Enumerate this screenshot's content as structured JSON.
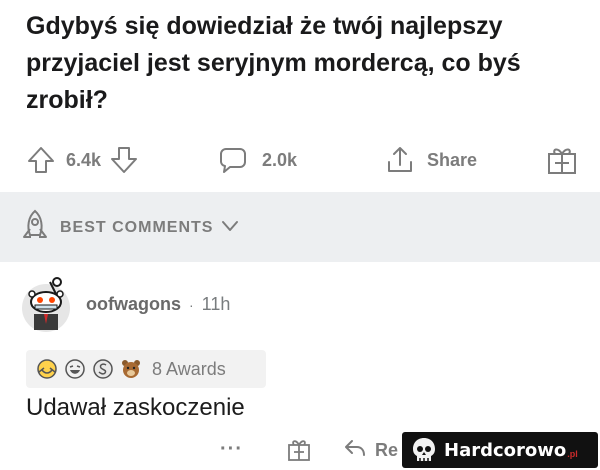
{
  "post": {
    "title": "Gdybyś się dowiedział że twój najlepszy przyjaciel jest seryjnym mordercą, co byś zrobił?"
  },
  "actions": {
    "vote_count": "6.4k",
    "comment_count": "2.0k",
    "share_label": "Share"
  },
  "sort": {
    "label": "BEST COMMENTS"
  },
  "comment": {
    "author": "oofwagons",
    "separator": "·",
    "age": "11h",
    "awards_label": "8 Awards",
    "body": "Udawał zaskoczenie",
    "more_label": "···",
    "reply_label": "Re"
  },
  "watermark": {
    "name": "Hardcorowo",
    "tld": ".pl"
  },
  "colors": {
    "muted": "#7c7c7c",
    "band": "#edeff1",
    "text": "#1c1c1c"
  },
  "icons": [
    "upvote-icon",
    "downvote-icon",
    "comment-icon",
    "share-icon",
    "gift-award-icon",
    "rocket-icon",
    "chevron-down-icon",
    "snoo-avatar-icon",
    "reply-icon",
    "skull-icon"
  ]
}
